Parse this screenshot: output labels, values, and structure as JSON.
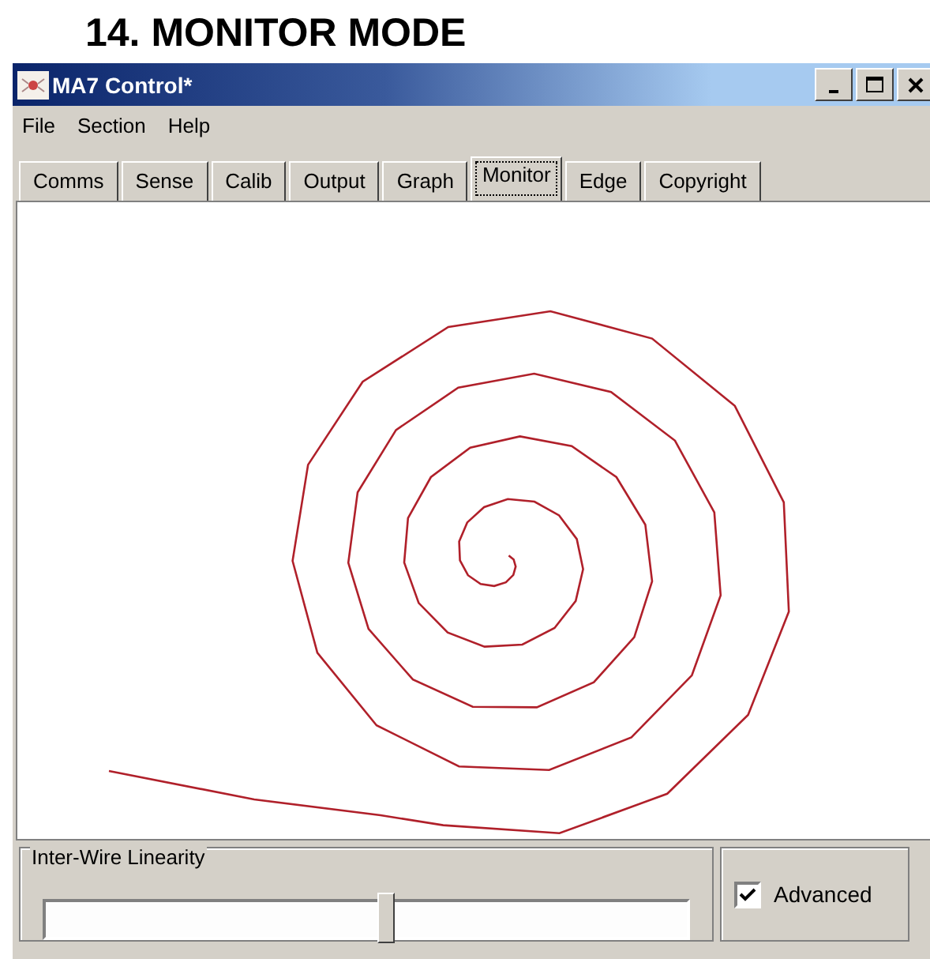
{
  "heading": "14. MONITOR MODE",
  "window": {
    "title": "MA7 Control*"
  },
  "menu": [
    "File",
    "Section",
    "Help"
  ],
  "tabs": [
    {
      "label": "Comms",
      "selected": false
    },
    {
      "label": "Sense",
      "selected": false
    },
    {
      "label": "Calib",
      "selected": false
    },
    {
      "label": "Output",
      "selected": false
    },
    {
      "label": "Graph",
      "selected": false
    },
    {
      "label": "Monitor",
      "selected": true
    },
    {
      "label": "Edge",
      "selected": false
    },
    {
      "label": "Copyright",
      "selected": false
    }
  ],
  "linearity": {
    "label": "Inter-Wire Linearity",
    "level": 0.53
  },
  "advanced": {
    "label": "Advanced",
    "checked": true
  }
}
